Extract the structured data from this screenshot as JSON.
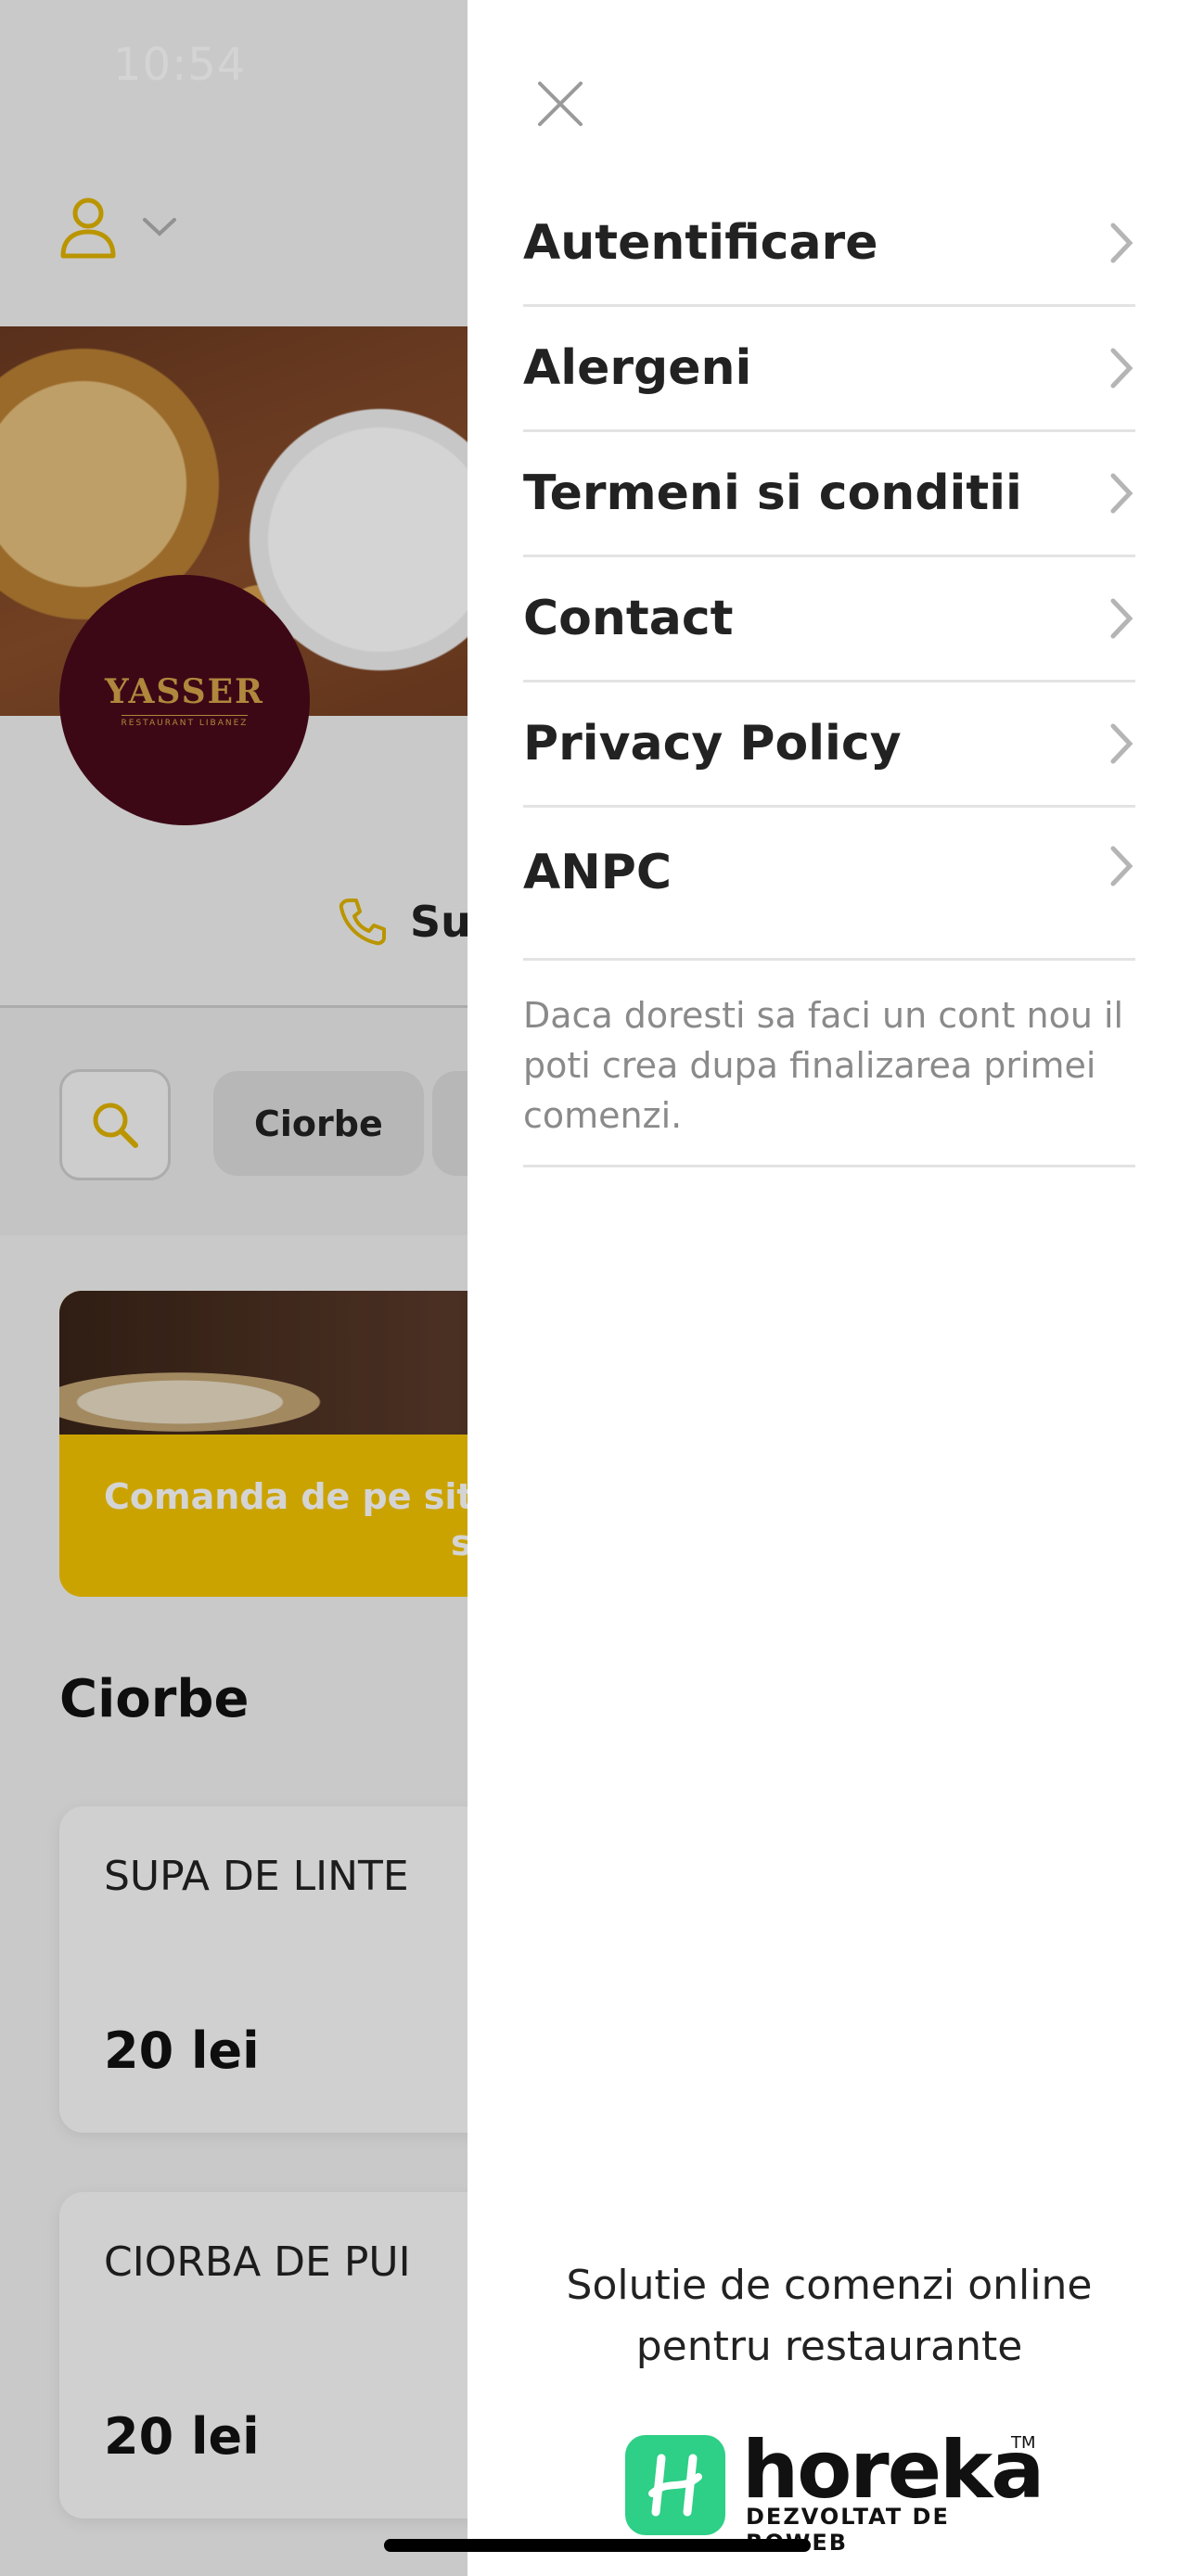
{
  "status_bar": {
    "time": "10:54"
  },
  "background": {
    "logo": {
      "name": "YASSER",
      "subtitle": "RESTAURANT LIBANEZ"
    },
    "phone_label": "Su",
    "categories": [
      "Ciorbe"
    ],
    "promo": {
      "line1": "Comanda de pe site",
      "line2": "s"
    },
    "section_title": "Ciorbe",
    "products": [
      {
        "name": "SUPA DE LINTE",
        "price": "20 lei"
      },
      {
        "name": "CIORBA DE PUI",
        "price": "20 lei"
      }
    ],
    "colors": {
      "accent": "#e0b400",
      "logo_bg": "#4a0a1a",
      "promo_bg": "#f5c400"
    }
  },
  "drawer": {
    "menu": [
      {
        "label": "Autentificare"
      },
      {
        "label": "Alergeni"
      },
      {
        "label": "Termeni si conditii"
      },
      {
        "label": "Contact"
      },
      {
        "label": "Privacy Policy"
      },
      {
        "label": "ANPC"
      }
    ],
    "note": "Daca doresti sa faci un cont nou il poti crea dupa finalizarea primei comenzi.",
    "tagline_line1": "Solutie de comenzi online",
    "tagline_line2": "pentru restaurante",
    "brand": {
      "name": "horeka",
      "tm": "TM",
      "sub": "DEZVOLTAT DE ROWEB",
      "color": "#2ecf86"
    }
  },
  "icons": {
    "close": "close-icon",
    "chevron": "chevron-right-icon",
    "user": "user-icon",
    "phone": "phone-icon",
    "search": "search-icon"
  }
}
